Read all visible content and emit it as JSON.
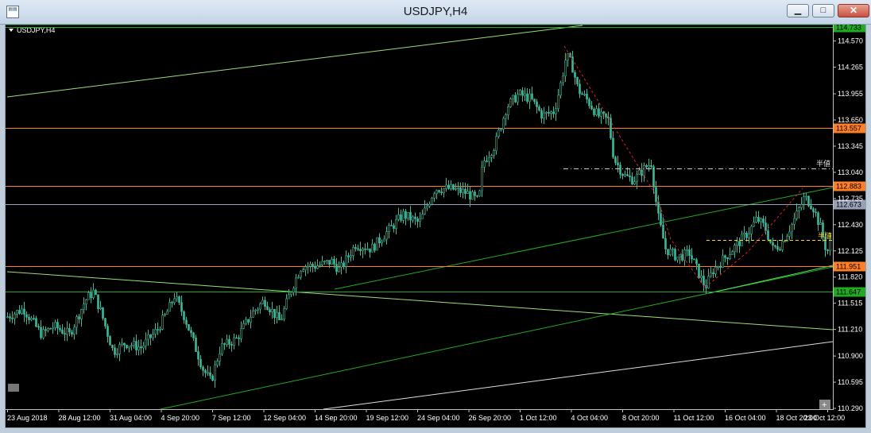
{
  "window": {
    "title": "USDJPY,H4",
    "minimize_glyph": "▁",
    "maximize_glyph": "□",
    "close_glyph": "✕"
  },
  "chart_data": {
    "type": "candlestick",
    "symbol_label": "USDJPY,H4",
    "price_axis": {
      "min": 110.29,
      "max": 114.733,
      "ticks": [
        "114.570",
        "114.265",
        "113.955",
        "113.650",
        "113.345",
        "113.040",
        "112.735",
        "112.430",
        "112.125",
        "111.820",
        "111.515",
        "111.210",
        "110.900",
        "110.595",
        "110.290"
      ]
    },
    "time_axis": {
      "labels": [
        "23 Aug 2018",
        "28 Aug 12:00",
        "31 Aug 04:00",
        "4 Sep 20:00",
        "7 Sep 12:00",
        "12 Sep 04:00",
        "14 Sep 20:00",
        "19 Sep 12:00",
        "24 Sep 04:00",
        "26 Sep 20:00",
        "1 Oct 12:00",
        "4 Oct 04:00",
        "8 Oct 20:00",
        "11 Oct 12:00",
        "16 Oct 04:00",
        "18 Oct 20:00",
        "23 Oct 12:00"
      ]
    },
    "horizontal_levels": [
      {
        "price": 114.733,
        "label": "114.733",
        "color": "#22aa22"
      },
      {
        "price": 113.557,
        "label": "113.557",
        "color": "#ff7f27"
      },
      {
        "price": 112.883,
        "label": "112.883",
        "color": "#ff7f27"
      },
      {
        "price": 112.673,
        "label": "112.673",
        "color": "#9aa0b8"
      },
      {
        "price": 111.951,
        "label": "111.951",
        "color": "#ff7f27"
      },
      {
        "price": 111.647,
        "label": "111.647",
        "color": "#22aa22"
      }
    ],
    "annotations": [
      {
        "text": "半値"
      },
      {
        "text": "半値"
      }
    ],
    "colors": {
      "candle": "#3cb89a",
      "grid": "#000000",
      "axis_text": "#ffffff",
      "background": "#000000"
    }
  }
}
